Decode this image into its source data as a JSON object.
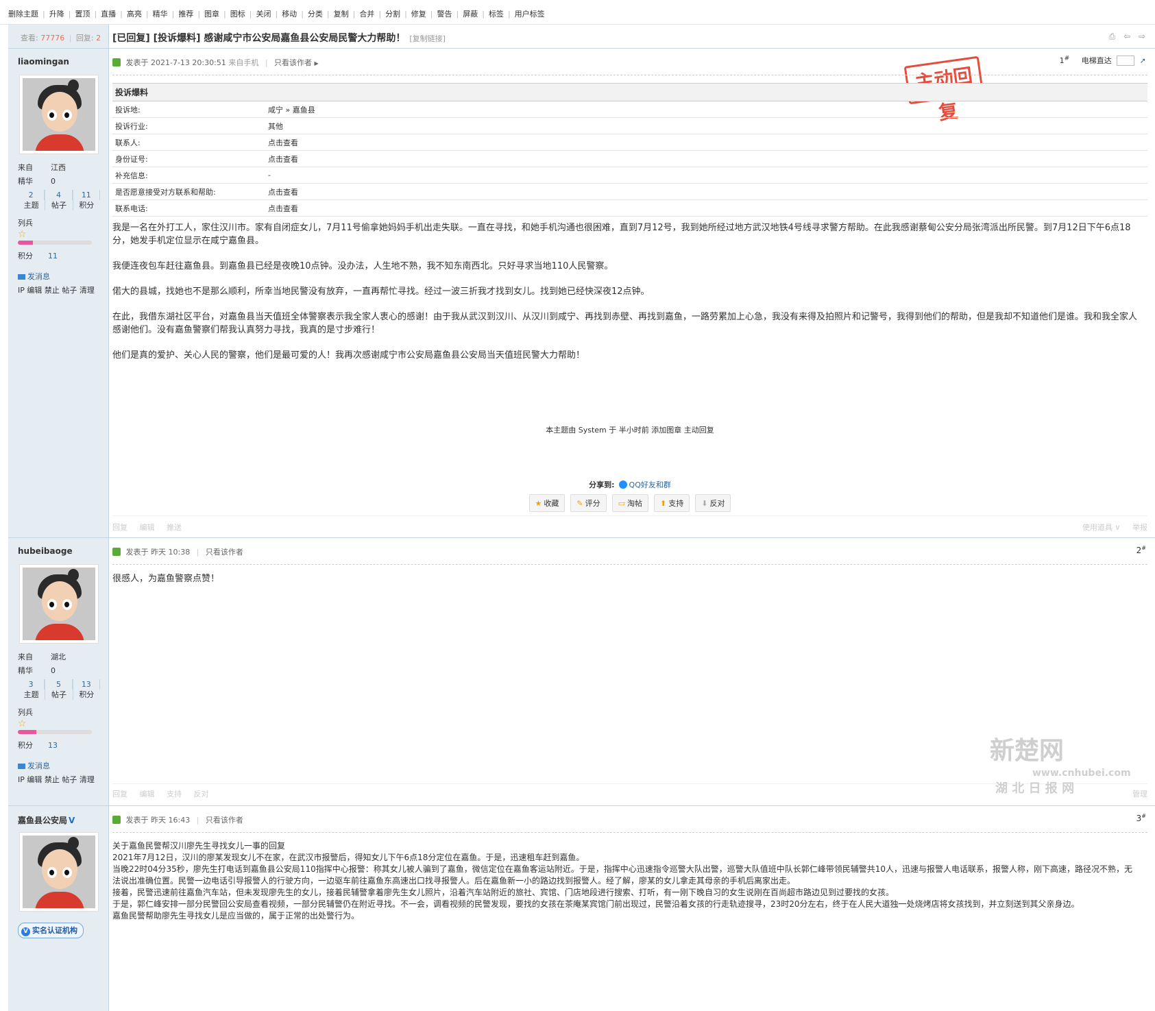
{
  "modbar": [
    "删除主题",
    "升降",
    "置顶",
    "直播",
    "高亮",
    "精华",
    "推荐",
    "图章",
    "图标",
    "关闭",
    "移动",
    "分类",
    "复制",
    "合并",
    "分割",
    "修复",
    "警告",
    "屏蔽",
    "标签",
    "用户标签"
  ],
  "header": {
    "views_label": "查看:",
    "views": "77776",
    "replies_label": "回复:",
    "replies": "2",
    "title": "[已回复] [投诉爆料] 感谢咸宁市公安局嘉鱼县公安局民警大力帮助！",
    "copy_link": "[复制链接]"
  },
  "posts": [
    {
      "username": "liaomingan",
      "from_label": "来自",
      "from": "江西",
      "digest_label": "精华",
      "digest": "0",
      "stats": [
        {
          "n": "2",
          "l": "主题"
        },
        {
          "n": "4",
          "l": "帖子"
        },
        {
          "n": "11",
          "l": "积分"
        }
      ],
      "rank": "列兵",
      "level_fill": 0.2,
      "score_label": "积分",
      "score": "11",
      "message_label": "发消息",
      "admin_links": "IP 编辑 禁止 帖子 清理",
      "posted": "发表于 2021-7-13 20:30:51",
      "device": "来自手机",
      "only_author": "只看该作者",
      "floor": "1",
      "floor_sup": "#",
      "stamp": "主动回复",
      "jump_label": "电梯直达"
    },
    {
      "username": "hubeibaoge",
      "from_label": "来自",
      "from": "湖北",
      "digest_label": "精华",
      "digest": "0",
      "stats": [
        {
          "n": "3",
          "l": "主题"
        },
        {
          "n": "5",
          "l": "帖子"
        },
        {
          "n": "13",
          "l": "积分"
        }
      ],
      "rank": "列兵",
      "level_fill": 0.25,
      "score_label": "积分",
      "score": "13",
      "message_label": "发消息",
      "admin_links": "IP 编辑 禁止 帖子 清理",
      "posted": "发表于 昨天 10:38",
      "only_author": "只看该作者",
      "floor": "2",
      "floor_sup": "#",
      "text": "很感人，为嘉鱼警察点赞！"
    },
    {
      "username": "嘉鱼县公安局",
      "verified_mark": "V",
      "certification": "实名认证机构",
      "posted": "发表于 昨天 16:43",
      "only_author": "只看该作者",
      "floor": "3",
      "floor_sup": "#",
      "lines": [
        "关于嘉鱼民警帮汉川廖先生寻找女儿一事的回复",
        "2021年7月12日，汉川的廖某发现女儿不在家，在武汉市报警后，得知女儿下午6点18分定位在嘉鱼。于是，迅速租车赶到嘉鱼。",
        "当晚22时04分35秒，廖先生打电话到嘉鱼县公安局110指挥中心报警：称其女儿被人骗到了嘉鱼，微信定位在嘉鱼客运站附近。于是，指挥中心迅速指令巡警大队出警，巡警大队值班中队长郭仁峰带领民辅警共10人，迅速与报警人电话联系，报警人称，刚下高速，路径况不熟，无法说出准确位置。民警一边电话引导报警人的行驶方向，一边驱车前往嘉鱼东高速出口找寻报警人。后在嘉鱼新一小的路边找到报警人。经了解，廖某的女儿拿走其母亲的手机后离家出走。",
        "接着，民警迅速前往嘉鱼汽车站，但未发现廖先生的女儿，接着民辅警拿着廖先生女儿照片，沿着汽车站附近的旅社、宾馆、门店地段进行搜索、打听，有一刚下晚自习的女生说刚在百尚超市路边见到过要找的女孩。",
        "于是，郭仁峰安排一部分民警回公安局查看视频，一部分民辅警仍在附近寻找。不一会，调看视频的民警发现，要找的女孩在茶庵某宾馆门前出现过，民警沿着女孩的行走轨迹搜寻，23时20分左右，终于在人民大道独一处烧烤店将女孩找到，并立刻送到其父亲身边。",
        "嘉鱼民警帮助廖先生寻找女儿是应当做的，属于正常的出处警行为。"
      ]
    }
  ],
  "complaint": {
    "heading": "投诉爆料",
    "rows": [
      {
        "k": "投诉地:",
        "v": "咸宁 » 嘉鱼县"
      },
      {
        "k": "投诉行业:",
        "v": "其他"
      },
      {
        "k": "联系人:",
        "v": "点击查看"
      },
      {
        "k": "身份证号:",
        "v": "点击查看"
      },
      {
        "k": "补充信息:",
        "v": "-"
      },
      {
        "k": "是否愿意接受对方联系和帮助:",
        "v": "点击查看"
      },
      {
        "k": "联系电话:",
        "v": "点击查看"
      }
    ]
  },
  "post1_paragraphs": [
    "我是一名在外打工人，家住汉川市。家有自闭症女儿，7月11号偷拿她妈妈手机出走失联。一直在寻找，和她手机沟通也很困难，直到7月12号，我到她所经过地方武汉地铁4号线寻求警方帮助。在此我感谢蔡甸公安分局张湾派出所民警。到7月12日下午6点18分，她发手机定位显示在咸宁嘉鱼县。",
    "我便连夜包车赶往嘉鱼县。到嘉鱼县已经是夜晚10点钟。没办法，人生地不熟，我不知东南西北。只好寻求当地110人民警察。",
    "偌大的县城，找她也不是那么顺利，所幸当地民警没有放弃，一直再帮忙寻找。经过一波三折我才找到女儿。找到她已经快深夜12点钟。",
    "在此，我借东湖社区平台，对嘉鱼县当天值班全体警察表示我全家人衷心的感谢！由于我从武汉到汉川、从汉川到咸宁、再找到赤壁、再找到嘉鱼，一路劳累加上心急，我没有来得及拍照片和记警号，我得到他们的帮助，但是我却不知道他们是谁。我和我全家人感谢他们。没有嘉鱼警察们帮我认真努力寻找，我真的是寸步难行！",
    "他们是真的爱护、关心人民的警察，他们是最可爱的人！我再次感谢咸宁市公安局嘉鱼县公安局当天值班民警大力帮助！"
  ],
  "sysnote": "本主题由 System 于 半小时前 添加图章 主动回复",
  "share": {
    "label": "分享到:",
    "link": "QQ好友和群"
  },
  "actions": [
    "收藏",
    "评分",
    "淘帖",
    "支持",
    "反对"
  ],
  "footer1": {
    "left": [
      "回复",
      "编辑",
      "推送"
    ],
    "right": [
      "使用道具 ∨",
      "举报"
    ]
  },
  "footer2": {
    "left": [
      "回复",
      "编辑",
      "支持",
      "反对"
    ],
    "right": [
      "管理"
    ]
  },
  "watermark": {
    "brand": "新楚网",
    "url": "www.cnhubei.com",
    "sub": "湖 北 日 报 网"
  },
  "header_icons": "⎙ ⇦ ⇨"
}
